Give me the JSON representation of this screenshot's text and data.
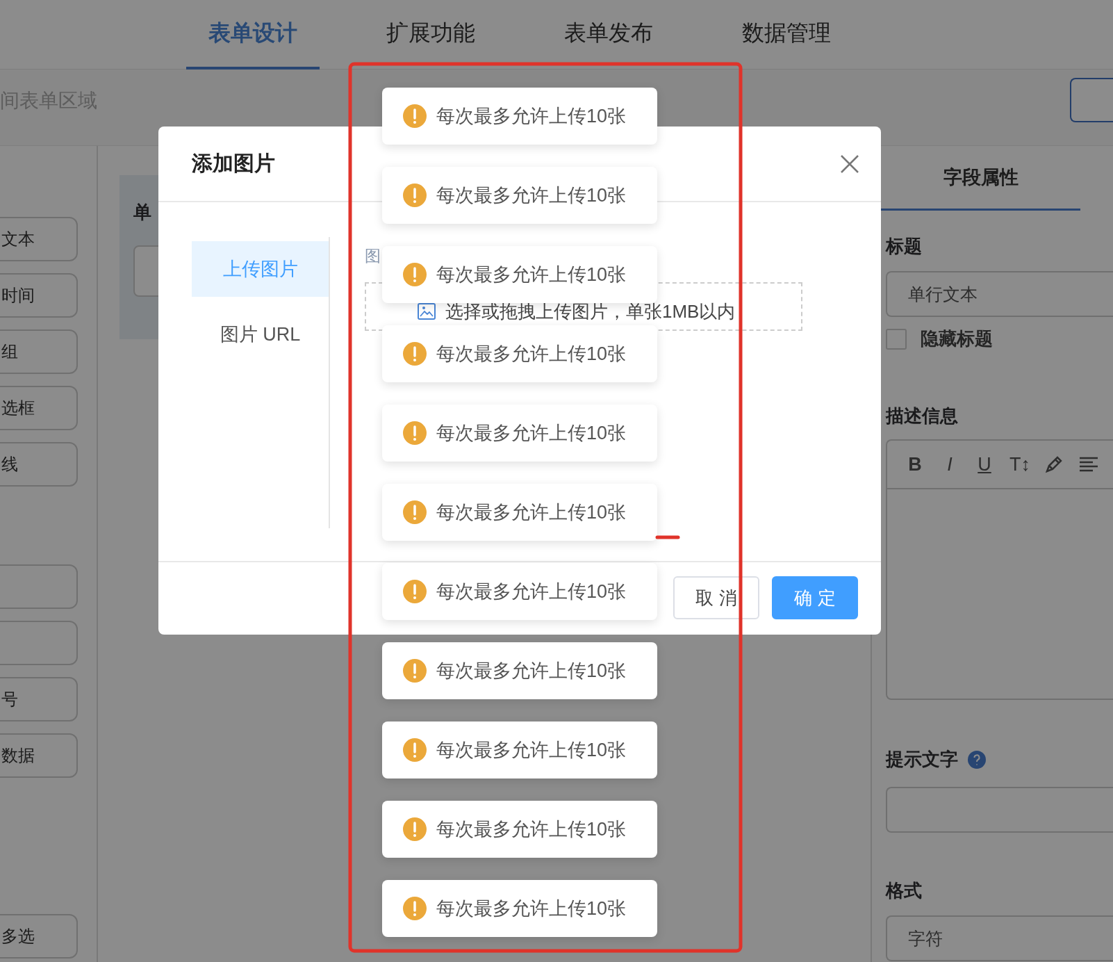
{
  "top_tabs": [
    {
      "label": "表单设计",
      "selected": true
    },
    {
      "label": "扩展功能",
      "selected": false
    },
    {
      "label": "表单发布",
      "selected": false
    },
    {
      "label": "数据管理",
      "selected": false
    }
  ],
  "toolbar": {
    "title": "间表单区域"
  },
  "component_groups": [
    {
      "items": [
        {
          "kind": "labeled",
          "label": "文本"
        },
        {
          "kind": "labeled",
          "label": "时间"
        },
        {
          "kind": "labeled",
          "label": "组"
        },
        {
          "kind": "labeled",
          "label": "选框"
        },
        {
          "kind": "labeled",
          "label": "线"
        }
      ]
    },
    {
      "items": [
        {
          "kind": "blank"
        },
        {
          "kind": "blank"
        },
        {
          "kind": "labeled",
          "label": "号"
        },
        {
          "kind": "labeled",
          "label": "数据"
        }
      ]
    },
    {
      "items": [
        {
          "kind": "labeled",
          "label": "多选"
        }
      ]
    }
  ],
  "canvas": {
    "field_label": "单"
  },
  "field_properties": {
    "tab": "字段属性",
    "title_label": "标题",
    "title_value": "单行文本",
    "hide_title": {
      "label": "隐藏标题",
      "checked": false
    },
    "description_label": "描述信息",
    "editor_tools": [
      "B",
      "I",
      "U",
      "T↕"
    ],
    "placeholder_label": "提示文字",
    "format_label": "格式",
    "format_value": "字符"
  },
  "dialog": {
    "title": "添加图片",
    "menu": [
      {
        "label": "上传图片",
        "selected": true
      },
      {
        "label": "图片 URL",
        "selected": false
      }
    ],
    "field_label": "图",
    "dropzone": "选择或拖拽上传图片，单张1MB以内",
    "buttons": [
      {
        "label": "取 消",
        "kind": "default"
      },
      {
        "label": "确 定",
        "kind": "primary"
      }
    ]
  },
  "messages": [
    {
      "text": "每次最多允许上传10张"
    },
    {
      "text": "每次最多允许上传10张"
    },
    {
      "text": "每次最多允许上传10张"
    },
    {
      "text": "每次最多允许上传10张"
    },
    {
      "text": "每次最多允许上传10张"
    },
    {
      "text": "每次最多允许上传10张"
    },
    {
      "text": "每次最多允许上传10张"
    },
    {
      "text": "每次最多允许上传10张"
    },
    {
      "text": "每次最多允许上传10张"
    },
    {
      "text": "每次最多允许上传10张"
    },
    {
      "text": "每次最多允许上传10张"
    }
  ]
}
